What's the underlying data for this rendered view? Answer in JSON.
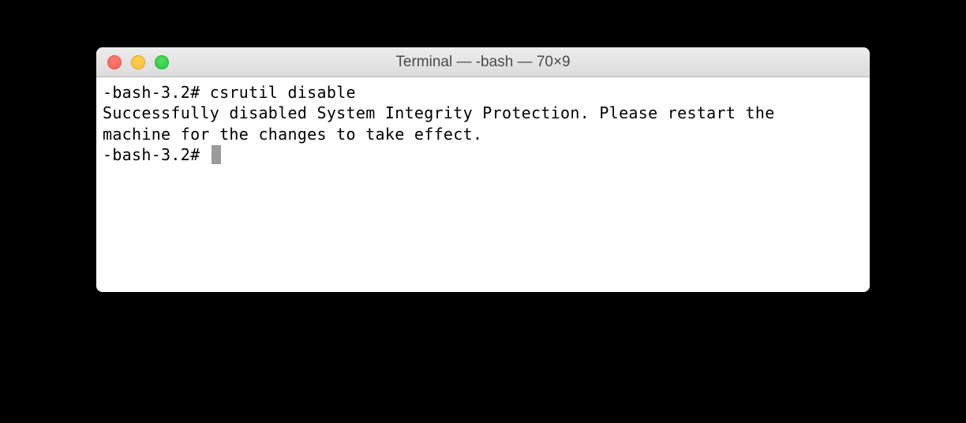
{
  "window": {
    "title": "Terminal — -bash — 70×9"
  },
  "terminal": {
    "line1_prompt": "-bash-3.2# ",
    "line1_command": "csrutil disable",
    "line2": "Successfully disabled System Integrity Protection. Please restart the",
    "line3": "machine for the changes to take effect.",
    "line4_prompt": "-bash-3.2# "
  }
}
